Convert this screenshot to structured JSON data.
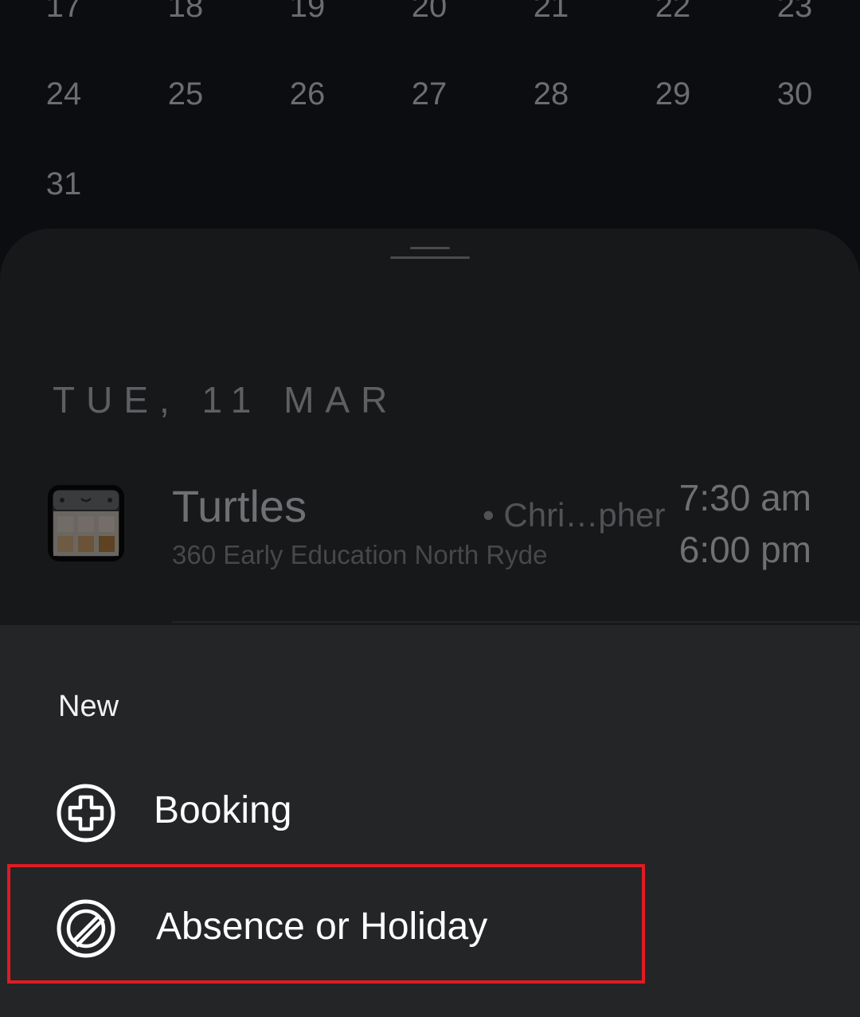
{
  "calendar": {
    "rows": [
      [
        "17",
        "18",
        "19",
        "20",
        "21",
        "22",
        "23"
      ],
      [
        "24",
        "25",
        "26",
        "27",
        "28",
        "29",
        "30"
      ],
      [
        "31"
      ]
    ]
  },
  "schedule": {
    "date_heading": "TUE, 11 MAR",
    "events": [
      {
        "title": "Turtles",
        "person": "• Chri…pher",
        "location": "360 Early Education North Ryde",
        "start_time": "7:30 am",
        "end_time": "6:00 pm",
        "icon": "room-calendar-icon"
      }
    ]
  },
  "new_menu": {
    "title": "New",
    "items": [
      {
        "label": "Booking",
        "icon": "plus-circle-icon"
      },
      {
        "label": "Absence or Holiday",
        "icon": "prohibited-circle-icon"
      }
    ]
  },
  "colors": {
    "highlight": "#e01b23",
    "sheet_background": "#242527",
    "background": "#0c0d10"
  }
}
